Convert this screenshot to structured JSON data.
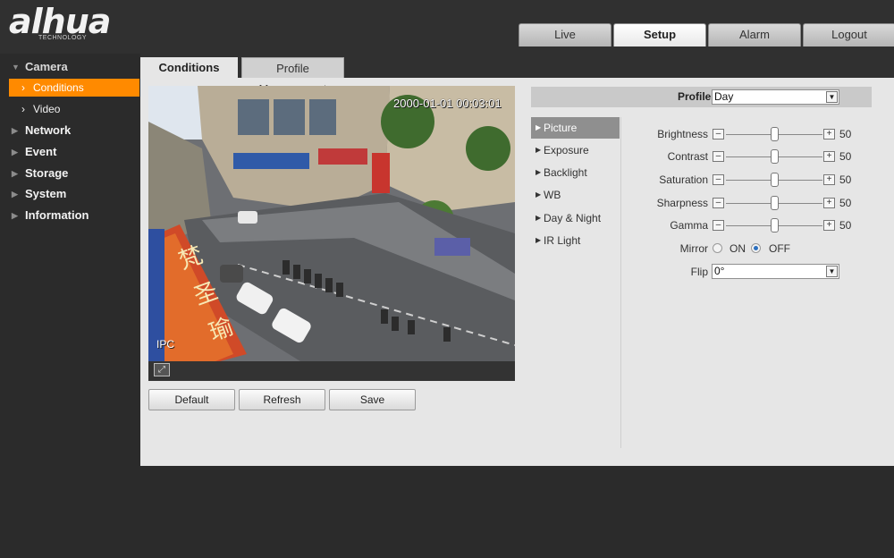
{
  "brand": {
    "logo_text": "alhua",
    "logo_sub": "TECHNOLOGY"
  },
  "top_tabs": [
    {
      "label": "Live"
    },
    {
      "label": "Setup"
    },
    {
      "label": "Alarm"
    },
    {
      "label": "Logout"
    }
  ],
  "sidebar": {
    "camera": "Camera",
    "conditions": "Conditions",
    "video": "Video",
    "network": "Network",
    "event": "Event",
    "storage": "Storage",
    "system": "System",
    "information": "Information"
  },
  "content_tabs": {
    "conditions": "Conditions",
    "profile": "Profile Management"
  },
  "video": {
    "timestamp": "2000-01-01 00:03:01",
    "channel": "IPC"
  },
  "buttons": {
    "default": "Default",
    "refresh": "Refresh",
    "save": "Save"
  },
  "profile": {
    "label": "Profile",
    "value": "Day"
  },
  "menu": [
    "Picture",
    "Exposure",
    "Backlight",
    "WB",
    "Day & Night",
    "IR Light"
  ],
  "picture": {
    "brightness": {
      "label": "Brightness",
      "value": "50"
    },
    "contrast": {
      "label": "Contrast",
      "value": "50"
    },
    "saturation": {
      "label": "Saturation",
      "value": "50"
    },
    "sharpness": {
      "label": "Sharpness",
      "value": "50"
    },
    "gamma": {
      "label": "Gamma",
      "value": "50"
    },
    "mirror": {
      "label": "Mirror",
      "on": "ON",
      "off": "OFF",
      "selected": "OFF"
    },
    "flip": {
      "label": "Flip",
      "value": "0°"
    }
  },
  "colors": {
    "accent": "#ff8a00",
    "header": "#303030",
    "panel": "#e6e6e6"
  }
}
